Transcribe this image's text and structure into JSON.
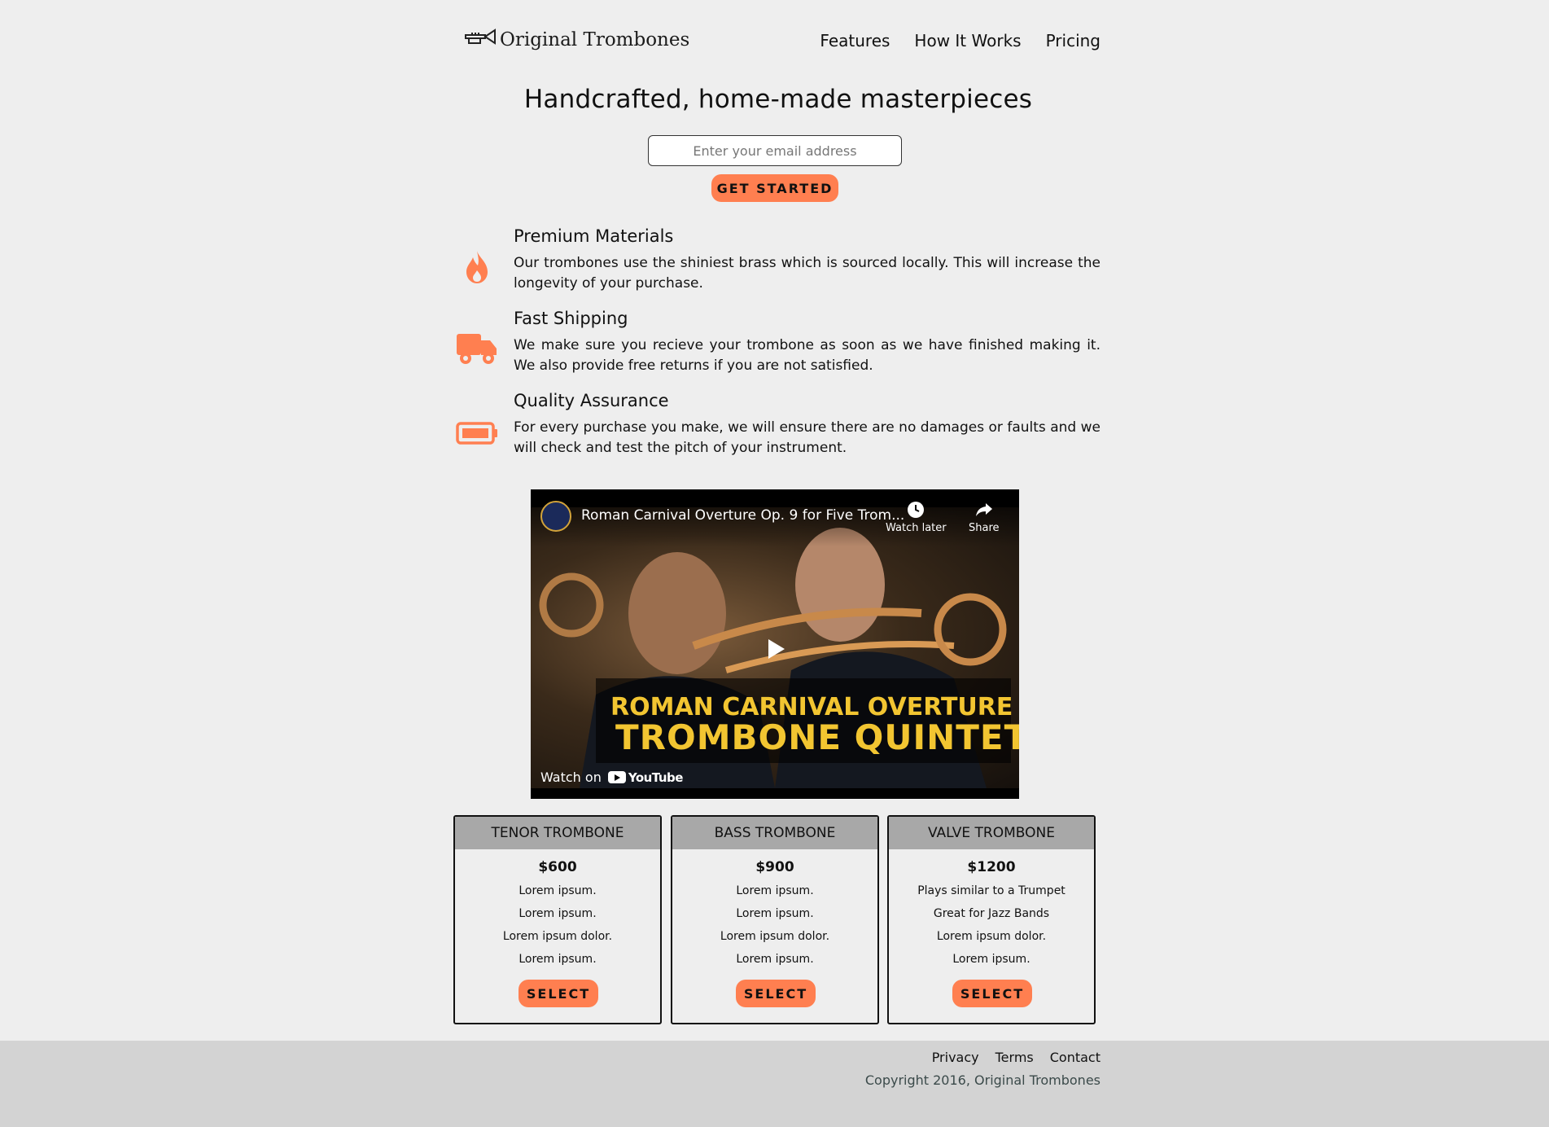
{
  "header": {
    "logo_text": "Original Trombones",
    "nav": [
      "Features",
      "How It Works",
      "Pricing"
    ]
  },
  "hero": {
    "title": "Handcrafted, home-made masterpieces",
    "email_placeholder": "Enter your email address",
    "cta_label": "GET STARTED"
  },
  "features": [
    {
      "icon": "fire-icon",
      "title": "Premium Materials",
      "text": "Our trombones use the shiniest brass which is sourced locally. This will increase the longevity of your purchase."
    },
    {
      "icon": "truck-icon",
      "title": "Fast Shipping",
      "text": "We make sure you recieve your trombone as soon as we have finished making it. We also provide free returns if you are not satisfied."
    },
    {
      "icon": "battery-icon",
      "title": "Quality Assurance",
      "text": "For every purchase you make, we will ensure there are no damages or faults and we will check and test the pitch of your instrument."
    }
  ],
  "video": {
    "title": "Roman Carnival Overture Op. 9 for Five Trom...",
    "watch_later": "Watch later",
    "share": "Share",
    "caption_line1": "ROMAN CARNIVAL OVERTURE",
    "caption_line2": "TROMBONE QUINTET",
    "watch_on": "Watch on",
    "youtube": "YouTube"
  },
  "plans": [
    {
      "name": "TENOR TROMBONE",
      "price": "$600",
      "features": [
        "Lorem ipsum.",
        "Lorem ipsum.",
        "Lorem ipsum dolor.",
        "Lorem ipsum."
      ],
      "button": "SELECT"
    },
    {
      "name": "BASS TROMBONE",
      "price": "$900",
      "features": [
        "Lorem ipsum.",
        "Lorem ipsum.",
        "Lorem ipsum dolor.",
        "Lorem ipsum."
      ],
      "button": "SELECT"
    },
    {
      "name": "VALVE TROMBONE",
      "price": "$1200",
      "features": [
        "Plays similar to a Trumpet",
        "Great for Jazz Bands",
        "Lorem ipsum dolor.",
        "Lorem ipsum."
      ],
      "button": "SELECT"
    }
  ],
  "footer": {
    "links": [
      "Privacy",
      "Terms",
      "Contact"
    ],
    "copyright": "Copyright 2016, Original Trombones"
  },
  "colors": {
    "accent": "#ff7f50",
    "background": "#eeeeee",
    "footer": "#d3d3d3",
    "plan_header": "#a8a8a8"
  }
}
